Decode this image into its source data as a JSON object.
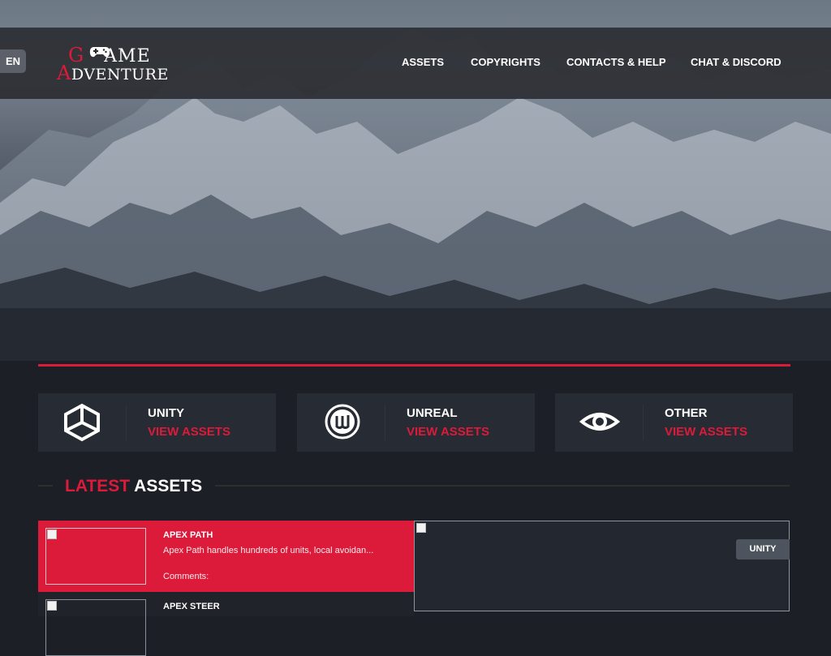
{
  "header": {
    "language": "EN",
    "logo": {
      "line1_red": "G",
      "line1_rest": "AME",
      "line2_red": "A",
      "line2_rest": "DVENTURE"
    },
    "nav": [
      "ASSETS",
      "COPYRIGHTS",
      "CONTACTS & HELP",
      "CHAT & DISCORD"
    ]
  },
  "categories": [
    {
      "title": "UNITY",
      "link": "VIEW ASSETS",
      "icon": "unity-icon"
    },
    {
      "title": "UNREAL",
      "link": "VIEW ASSETS",
      "icon": "unreal-icon"
    },
    {
      "title": "OTHER",
      "link": "VIEW ASSETS",
      "icon": "eye-icon"
    }
  ],
  "latest": {
    "title_red": "LATEST",
    "title_rest": " ASSETS",
    "items": [
      {
        "title": "APEX PATH",
        "description": "Apex Path handles hundreds of units, local avoidan...",
        "comments": "Comments:"
      },
      {
        "title": "APEX STEER"
      }
    ],
    "preview_badge": "UNITY"
  },
  "colors": {
    "accent": "#dc1a3a",
    "background": "#1c1f26",
    "card": "#272b33"
  }
}
